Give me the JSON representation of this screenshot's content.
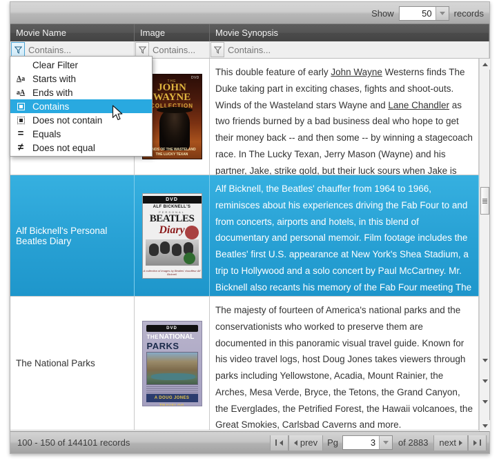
{
  "toolbar": {
    "show_label": "Show",
    "records_value": "50",
    "records_label": "records"
  },
  "columns": [
    {
      "label": "Movie Name",
      "filter_placeholder": "Contains...",
      "filter_value": ""
    },
    {
      "label": "Image",
      "filter_placeholder": "Contains...",
      "filter_value": ""
    },
    {
      "label": "Movie Synopsis",
      "filter_placeholder": "Contains...",
      "filter_value": ""
    }
  ],
  "filter_menu": {
    "open_for_column": "Movie Name",
    "selected": "Contains",
    "highlight_color": "#29a9e0",
    "items": [
      {
        "label": "Clear Filter",
        "icon": "none"
      },
      {
        "label": "Starts with",
        "icon": "starts-with-icon"
      },
      {
        "label": "Ends with",
        "icon": "ends-with-icon"
      },
      {
        "label": "Contains",
        "icon": "contains-icon"
      },
      {
        "label": "Does not contain",
        "icon": "does-not-contain-icon"
      },
      {
        "label": "Equals",
        "icon": "equals-icon"
      },
      {
        "label": "Does not equal",
        "icon": "does-not-equal-icon"
      }
    ]
  },
  "rows": [
    {
      "name": "",
      "poster": "The John Wayne Collection - Winds of the Wasteland / The Lucky Texan",
      "poster_lines": {
        "top": "THE",
        "l1": "JOHN",
        "l2": "WAYNE",
        "l3": "COLLECTION",
        "dvd": "DVD",
        "footer1": "WINDS OF THE WASTELAND",
        "footer2": "THE LUCKY TEXAN"
      },
      "synopsis_html": "This double feature of early <u>John Wayne</u> Westerns finds The Duke taking part in exciting chases, fights and shoot-outs. Winds of the Wasteland stars Wayne and <u>Lane Chandler</u> as two friends burned by a bad business deal who hope to get their money back -- and then some -- by winning a stagecoach race. In The Lucky Texan, Jerry Mason (Wayne) and his partner, Jake, strike gold, but their luck sours when Jake is shot and Jerry is framed for his murder.",
      "selected": false
    },
    {
      "name": "Alf Bicknell's Personal Beatles Diary",
      "poster": "Alf Bicknell's Personal Beatles Diary",
      "poster_lines": {
        "dvd": "DVD",
        "nm": "ALF BICKNELL'S",
        "pers": "PERSONAL",
        "bt": "BEATLES",
        "dy": "Diary",
        "cap": "A collection of images by Beatles' chauffeur Alf Bicknell"
      },
      "synopsis_html": "Alf Bicknell, the Beatles' chauffer from 1964 to 1966, reminisces about his experiences driving the Fab Four to and from concerts, airports and hotels, in this blend of documentary and personal memoir. Film footage includes the Beatles' first U.S. appearance at New York's Shea Stadium, a trip to Hollywood and a solo concert by Paul McCartney. Mr. Bicknell also recants his memory of the Fab Four meeting The King of Rock and Roll, Elvis Presley.",
      "selected": true
    },
    {
      "name": "The National Parks",
      "poster": "The National Parks - A Doug Jones Travelog",
      "poster_lines": {
        "dvd": "DVD",
        "the": "THE",
        "national": "NATIONAL",
        "parks": "PARKS",
        "travelog": "A DOUG JONES TRAVELOG"
      },
      "synopsis_html": "The majesty of fourteen of America's national parks and the conservationists who worked to preserve them are documented in this panoramic visual travel guide. Known for his video travel logs, host Doug Jones takes viewers through parks including Yellowstone, Acadia, Mount Rainier, the Arches, Mesa Verde, Bryce, the Tetons, the Grand Canyon, the Everglades, the Petrified Forest, the Hawaii volcanoes, the Great Smokies, Carlsbad Caverns and more.",
      "selected": false
    }
  ],
  "footer": {
    "record_range": "100 - 150 of 144101 records",
    "first_label": "",
    "prev_label": "prev",
    "pg_label": "Pg",
    "page_value": "3",
    "of_label": "of 2883",
    "next_label": "next",
    "last_label": ""
  }
}
